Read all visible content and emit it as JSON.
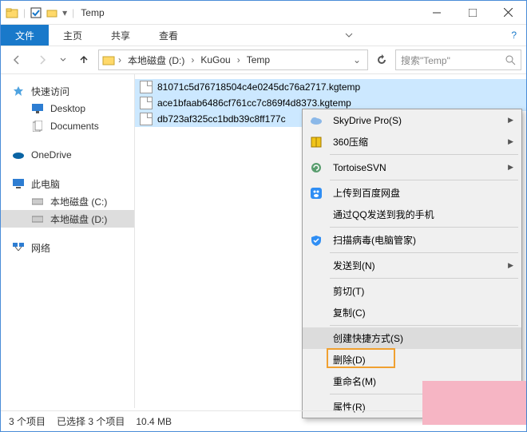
{
  "window": {
    "title": "Temp"
  },
  "ribbon": {
    "file": "文件",
    "tabs": [
      "主页",
      "共享",
      "查看"
    ]
  },
  "breadcrumb": [
    "本地磁盘 (D:)",
    "KuGou",
    "Temp"
  ],
  "search": {
    "placeholder": "搜索\"Temp\""
  },
  "sidebar": {
    "quick": {
      "label": "快速访问",
      "items": [
        "Desktop",
        "Documents"
      ]
    },
    "onedrive": "OneDrive",
    "thispc": {
      "label": "此电脑",
      "drives": [
        "本地磁盘 (C:)",
        "本地磁盘 (D:)"
      ]
    },
    "network": "网络"
  },
  "files": [
    "81071c5d76718504c4e0245dc76a2717.kgtemp",
    "ace1bfaab6486cf761cc7c869f4d8373.kgtemp",
    "db723af325cc1bdb39c8ff177c"
  ],
  "context_menu": [
    {
      "label": "SkyDrive Pro(S)",
      "icon": "cloud",
      "sub": true
    },
    {
      "label": "360压缩",
      "icon": "zip",
      "sub": true
    },
    {
      "sep": true
    },
    {
      "label": "TortoiseSVN",
      "icon": "svn",
      "sub": true
    },
    {
      "sep": true
    },
    {
      "label": "上传到百度网盘",
      "icon": "baidu"
    },
    {
      "label": "通过QQ发送到我的手机",
      "icon": ""
    },
    {
      "sep": true
    },
    {
      "label": "扫描病毒(电脑管家)",
      "icon": "shield"
    },
    {
      "sep": true
    },
    {
      "label": "发送到(N)",
      "sub": true
    },
    {
      "sep": true
    },
    {
      "label": "剪切(T)"
    },
    {
      "label": "复制(C)"
    },
    {
      "sep": true
    },
    {
      "label": "创建快捷方式(S)",
      "hover": true
    },
    {
      "label": "删除(D)",
      "highlight": true
    },
    {
      "label": "重命名(M)"
    },
    {
      "sep": true
    },
    {
      "label": "属性(R)"
    }
  ],
  "status": {
    "count": "3 个项目",
    "selection": "已选择 3 个项目",
    "size": "10.4 MB"
  }
}
